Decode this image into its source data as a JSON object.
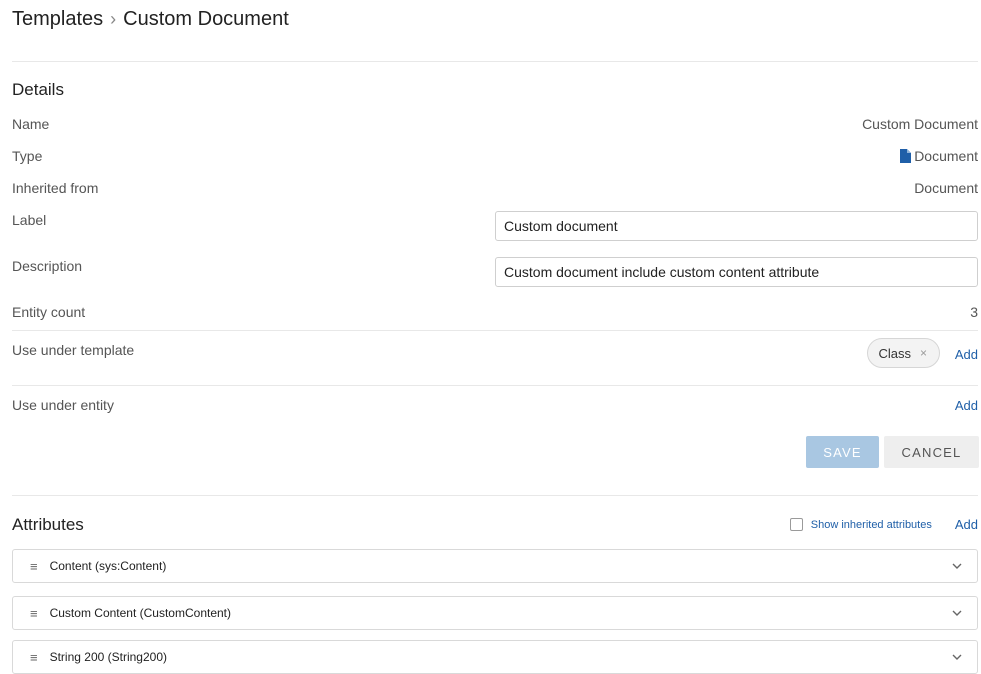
{
  "breadcrumb": {
    "root": "Templates",
    "separator": "›",
    "current": "Custom Document"
  },
  "details": {
    "title": "Details",
    "name_label": "Name",
    "name_value": "Custom Document",
    "type_label": "Type",
    "type_value": "Document",
    "type_icon": "document-icon",
    "inherited_label": "Inherited from",
    "inherited_value": "Document",
    "label_label": "Label",
    "label_value": "Custom document",
    "description_label": "Description",
    "description_value": "Custom document include custom content attribute",
    "entity_count_label": "Entity count",
    "entity_count_value": "3",
    "use_under_template_label": "Use under template",
    "use_under_template_chip": "Class",
    "chip_remove": "×",
    "use_under_entity_label": "Use under entity",
    "add_label": "Add"
  },
  "actions": {
    "save": "SAVE",
    "cancel": "CANCEL"
  },
  "attributes": {
    "title": "Attributes",
    "show_inherited_label": "Show inherited attributes",
    "add_label": "Add",
    "items": [
      {
        "label": "Content (sys:Content)"
      },
      {
        "label": "Custom Content (CustomContent)"
      },
      {
        "label": "String 200 (String200)"
      }
    ]
  },
  "colors": {
    "link": "#1f5fa8",
    "save_disabled": "#a9c7e2",
    "icon_blue": "#1f5fa8"
  }
}
